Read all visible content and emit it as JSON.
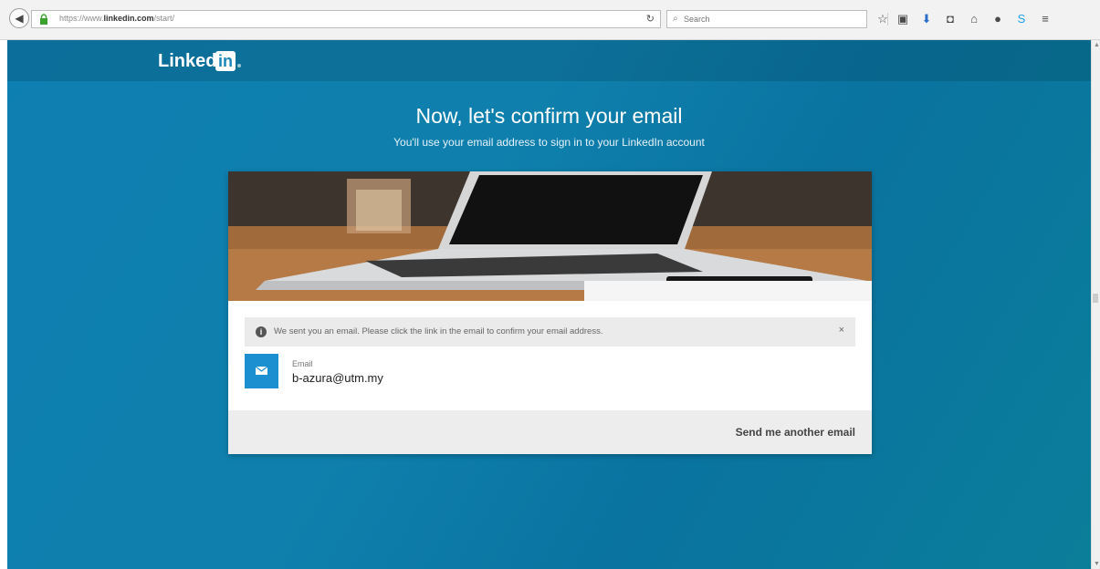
{
  "browser": {
    "url_prefix": "https://www.",
    "url_domain": "linkedin.com",
    "url_path": "/start/",
    "search_placeholder": "Search",
    "toolbar_icons": [
      "bookmark-star-icon",
      "clipboard-icon",
      "download-icon",
      "pocket-icon",
      "home-icon",
      "chat-icon",
      "skype-icon",
      "menu-icon"
    ]
  },
  "page": {
    "logo_text": "Linked",
    "logo_in": "in",
    "title": "Now, let's confirm your email",
    "subtitle": "You'll use your email address to sign in to your LinkedIn account",
    "alert_text": "We sent you an email. Please click the link in the email to confirm your email address.",
    "close_label": "×",
    "email_label": "Email",
    "email_value": "b-azura@utm.my",
    "send_again": "Send me another email"
  },
  "colors": {
    "accent": "#1b8fcf",
    "background": "#0e7fb1"
  }
}
